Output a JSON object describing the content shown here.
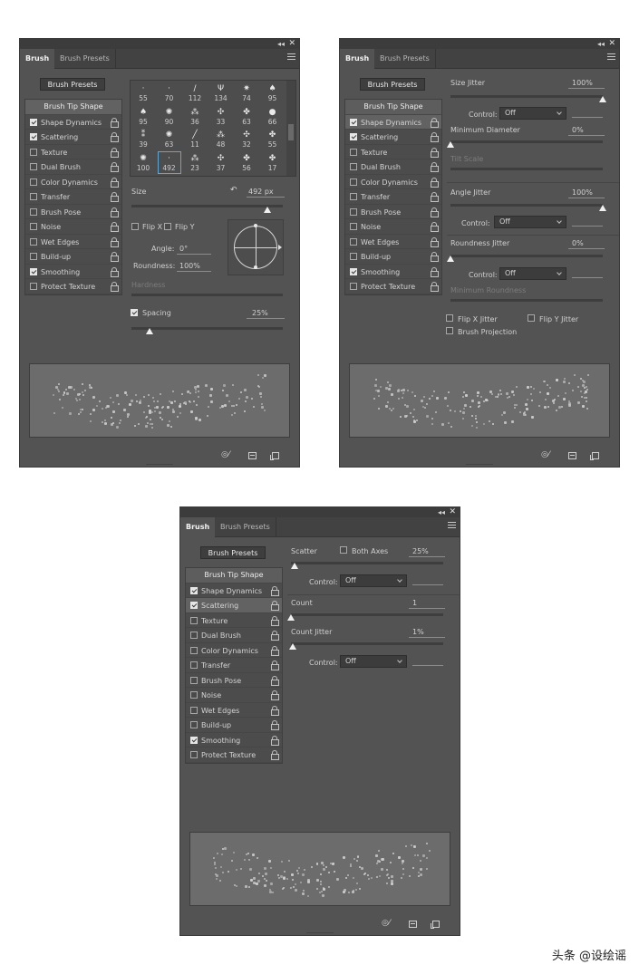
{
  "tabs": {
    "brush": "Brush",
    "brush_presets": "Brush Presets"
  },
  "presets_button": "Brush Presets",
  "brush_tip_shape": "Brush Tip Shape",
  "options": [
    {
      "label": "Shape Dynamics",
      "checked": true
    },
    {
      "label": "Scattering",
      "checked": true
    },
    {
      "label": "Texture",
      "checked": false
    },
    {
      "label": "Dual Brush",
      "checked": false
    },
    {
      "label": "Color Dynamics",
      "checked": false
    },
    {
      "label": "Transfer",
      "checked": false
    },
    {
      "label": "Brush Pose",
      "checked": false
    },
    {
      "label": "Noise",
      "checked": false
    },
    {
      "label": "Wet Edges",
      "checked": false
    },
    {
      "label": "Build-up",
      "checked": false
    },
    {
      "label": "Smoothing",
      "checked": true
    },
    {
      "label": "Protect Texture",
      "checked": false
    }
  ],
  "panel1": {
    "tips": [
      "55",
      "70",
      "112",
      "134",
      "74",
      "95",
      "95",
      "90",
      "36",
      "33",
      "63",
      "66",
      "39",
      "63",
      "11",
      "48",
      "32",
      "55",
      "100",
      "492",
      "23",
      "37",
      "56",
      "17"
    ],
    "size_label": "Size",
    "size_value": "492 px",
    "size_level": 0.9,
    "flip_x": "Flip X",
    "flip_y": "Flip Y",
    "angle_label": "Angle:",
    "angle_value": "0°",
    "roundness_label": "Roundness:",
    "roundness_value": "100%",
    "hardness_label": "Hardness",
    "spacing_label": "Spacing",
    "spacing_value": "25%",
    "spacing_checked": true,
    "spacing_level": 0.12
  },
  "panel2": {
    "size_jitter_label": "Size Jitter",
    "size_jitter_value": "100%",
    "control_label": "Control:",
    "control_value": "Off",
    "min_diameter_label": "Minimum Diameter",
    "min_diameter_value": "0%",
    "tilt_scale_label": "Tilt Scale",
    "angle_jitter_label": "Angle Jitter",
    "angle_jitter_value": "100%",
    "roundness_jitter_label": "Roundness Jitter",
    "roundness_jitter_value": "0%",
    "min_roundness_label": "Minimum Roundness",
    "flip_x_jitter": "Flip X Jitter",
    "flip_y_jitter": "Flip Y Jitter",
    "brush_projection": "Brush Projection"
  },
  "panel3": {
    "scatter_label": "Scatter",
    "both_axes_label": "Both Axes",
    "scatter_value": "25%",
    "control_label": "Control:",
    "control_value": "Off",
    "count_label": "Count",
    "count_value": "1",
    "count_jitter_label": "Count Jitter",
    "count_jitter_value": "1%"
  },
  "watermark": "头条 @设绘谣"
}
